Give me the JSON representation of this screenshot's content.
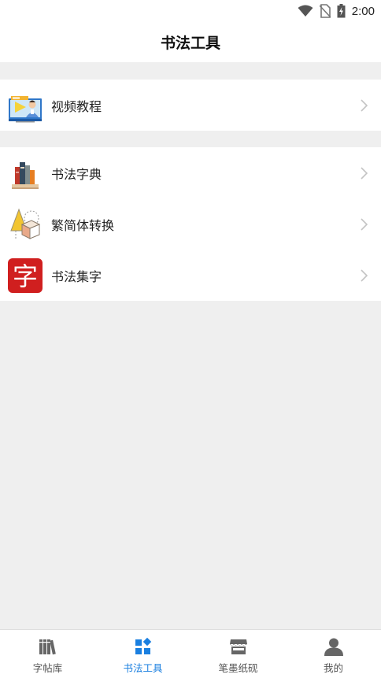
{
  "status": {
    "time": "2:00"
  },
  "header": {
    "title": "书法工具"
  },
  "sections": [
    {
      "items": [
        {
          "label": "视频教程",
          "icon": "video-tutorial-icon"
        }
      ]
    },
    {
      "items": [
        {
          "label": "书法字典",
          "icon": "books-icon"
        },
        {
          "label": "繁简体转换",
          "icon": "shapes-convert-icon"
        },
        {
          "label": "书法集字",
          "icon": "zi-character-icon",
          "icon_text": "字"
        }
      ]
    }
  ],
  "tabbar": {
    "tabs": [
      {
        "label": "字帖库",
        "icon": "bookshelf-icon",
        "active": false
      },
      {
        "label": "书法工具",
        "icon": "tools-grid-icon",
        "active": true
      },
      {
        "label": "笔墨纸砚",
        "icon": "store-icon",
        "active": false
      },
      {
        "label": "我的",
        "icon": "user-icon",
        "active": false
      }
    ]
  },
  "colors": {
    "accent": "#1a7fe0",
    "background": "#efefef",
    "zi_icon_red": "#d01f1f"
  }
}
